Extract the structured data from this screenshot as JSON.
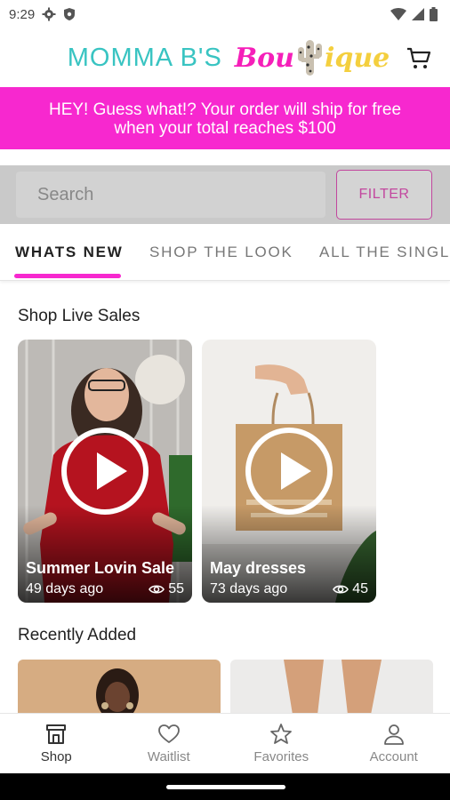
{
  "status_bar": {
    "time": "9:29",
    "icons": [
      "gear-icon",
      "shield-icon",
      "wifi-icon",
      "signal-icon",
      "battery-icon"
    ]
  },
  "header": {
    "logo_left": "MOMMA B'S",
    "logo_right_start": "Bou",
    "logo_right_end": "ique",
    "cart_icon": "cart-icon"
  },
  "promo": {
    "line1": "HEY! Guess what!? Your order will ship for free",
    "line2": "when your total reaches $100",
    "color": "#f728cf"
  },
  "search": {
    "placeholder": "Search",
    "filter_label": "FILTER"
  },
  "tabs": [
    {
      "label": "WHATS NEW",
      "active": true
    },
    {
      "label": "SHOP THE LOOK",
      "active": false
    },
    {
      "label": "ALL THE SINGLI",
      "active": false
    }
  ],
  "live_sales": {
    "title": "Shop Live Sales",
    "videos": [
      {
        "title": "Summer Lovin Sale",
        "age": "49 days ago",
        "views": "55"
      },
      {
        "title": "May dresses",
        "age": "73 days ago",
        "views": "45"
      }
    ]
  },
  "recently_added": {
    "title": "Recently Added"
  },
  "bottom_nav": [
    {
      "label": "Shop",
      "icon": "store-icon",
      "active": true
    },
    {
      "label": "Waitlist",
      "icon": "heart-icon",
      "active": false
    },
    {
      "label": "Favorites",
      "icon": "star-icon",
      "active": false
    },
    {
      "label": "Account",
      "icon": "person-icon",
      "active": false
    }
  ],
  "colors": {
    "accent_pink": "#f728cf",
    "logo_teal": "#39c4c2",
    "logo_yellow": "#f4cf3e",
    "filter_border": "#c2479e"
  }
}
